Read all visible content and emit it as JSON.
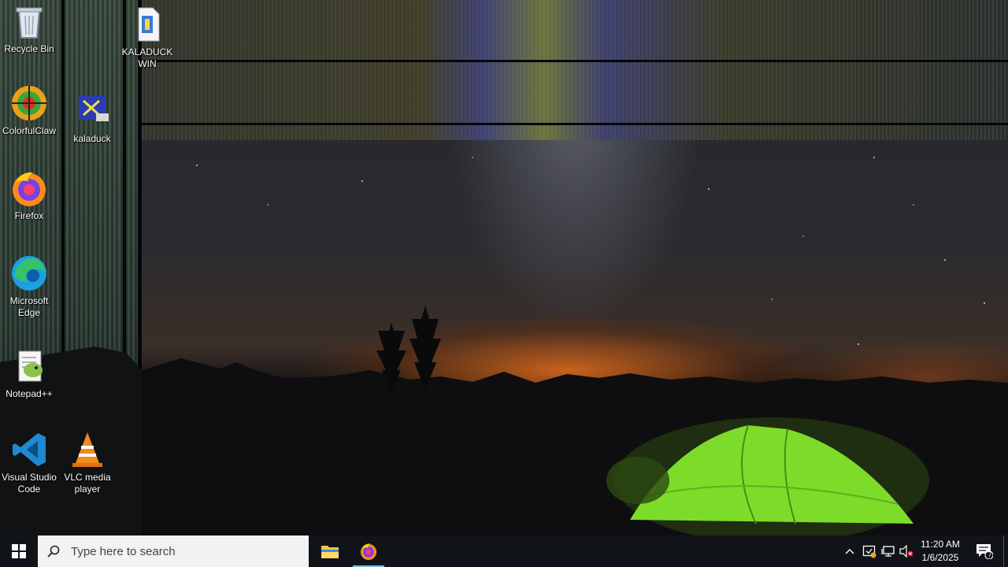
{
  "desktop": {
    "icons": [
      {
        "id": "recycle-bin",
        "label": "Recycle Bin"
      },
      {
        "id": "kaladuckwin",
        "label": "KALADUCKWIN"
      },
      {
        "id": "colorful-app",
        "label": "ColorfulClaw"
      },
      {
        "id": "kaladuck-network",
        "label": "kaladuck"
      },
      {
        "id": "firefox",
        "label": "Firefox"
      },
      {
        "id": "edge",
        "label": "Microsoft Edge"
      },
      {
        "id": "notepadpp",
        "label": "Notepad++"
      },
      {
        "id": "vscode",
        "label": "Visual Studio Code"
      },
      {
        "id": "vlc",
        "label": "VLC media player"
      }
    ]
  },
  "taskbar": {
    "search": {
      "placeholder": "Type here to search"
    },
    "pinned": [
      {
        "name": "File Explorer",
        "icon": "folder-icon"
      },
      {
        "name": "Firefox",
        "icon": "firefox-icon",
        "active": true
      }
    ],
    "tray": {
      "chevron_icon": "chevron-up-icon",
      "security_icon": "security-alert-icon",
      "network_icon": "network-icon",
      "volume_icon": "volume-muted-icon"
    },
    "clock": {
      "time": "11:20 AM",
      "date": "1/6/2025"
    },
    "notifications": {
      "count": "7"
    }
  },
  "colors": {
    "taskbar_bg": "#101418",
    "accent": "#76b9ed",
    "tent_green": "#7ddc2a",
    "horizon_orange": "#e06a1e"
  }
}
